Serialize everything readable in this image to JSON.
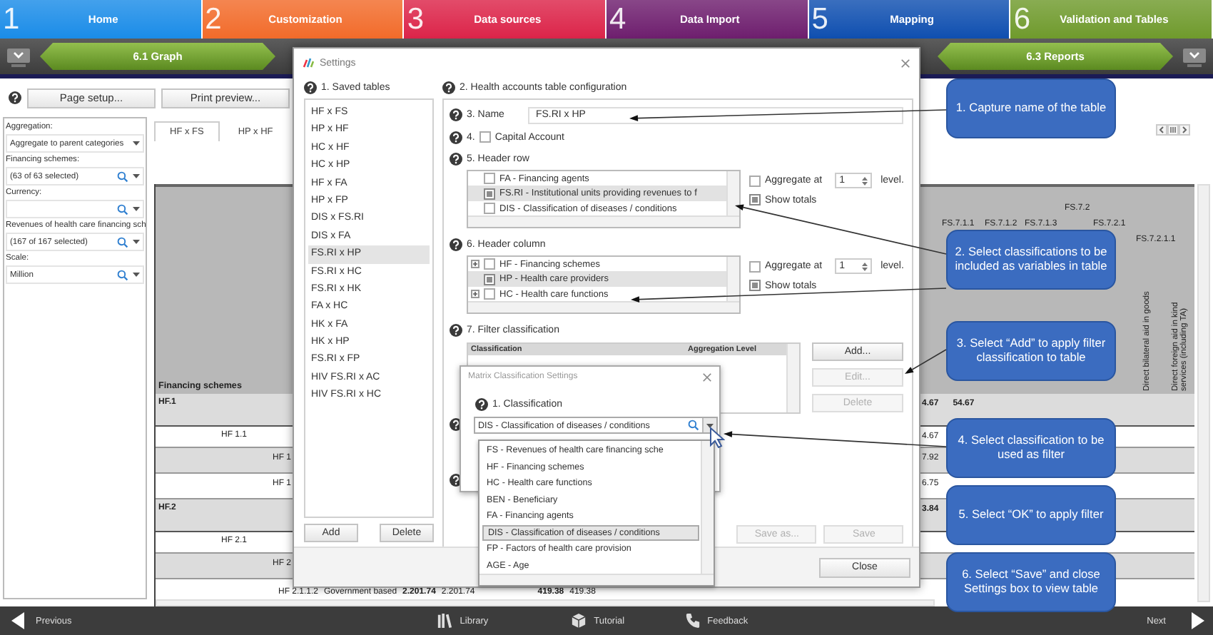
{
  "nav_steps": [
    {
      "number": "1",
      "label": "Home",
      "color": "#1a8ce8"
    },
    {
      "number": "2",
      "label": "Customization",
      "color": "#f26b2a"
    },
    {
      "number": "3",
      "label": "Data sources",
      "color": "#dc2449"
    },
    {
      "number": "4",
      "label": "Data Import",
      "color": "#6e1e6e"
    },
    {
      "number": "5",
      "label": "Mapping",
      "color": "#0f4fb0"
    },
    {
      "number": "6",
      "label": "Validation and Tables",
      "color": "#6f9a2c"
    }
  ],
  "sub_steps": [
    {
      "label": "6.1 Graph"
    },
    {
      "label": "6.3 Reports"
    }
  ],
  "toolbar": {
    "buttons": [
      "Page setup...",
      "Print preview..."
    ]
  },
  "filters": [
    {
      "label": "Aggregation:",
      "kind": "dropdown",
      "value": "Aggregate to parent categories"
    },
    {
      "label": "Financing schemes:",
      "kind": "search",
      "value": "(63 of 63 selected)"
    },
    {
      "label": "Currency:",
      "kind": "search"
    },
    {
      "label": "Revenues of health care financing sch",
      "kind": "search",
      "value": "(167 of 167 selected)"
    },
    {
      "label": "Scale:",
      "kind": "search",
      "value": "Million"
    }
  ],
  "report": {
    "tabs": [
      {
        "label": "HF x FS",
        "selected": true
      },
      {
        "label": "HP x HF",
        "selected": false
      }
    ],
    "column_headers": [
      [
        "FS.7.2"
      ],
      [
        "FS.7.1.1",
        "FS.7.1.2",
        "FS.7.1.3",
        "FS.7.2.1"
      ],
      [
        "FS.7.2.1.1"
      ]
    ],
    "column_titles": [
      "Direct bilateral aid in goods",
      "Direct foreign aid in kind services (including TA)"
    ],
    "row_header": "Financing schemes",
    "rows": [
      {
        "kind": "group",
        "shaded": true,
        "label": "HF.1",
        "values": [
          "4.67",
          "54.67"
        ]
      },
      {
        "kind": "sub",
        "shaded": false,
        "label": "HF 1.1",
        "values": [
          "4.67"
        ]
      },
      {
        "kind": "item",
        "shaded": true,
        "label": "HF 1",
        "values": [
          "7.92"
        ]
      },
      {
        "kind": "item",
        "shaded": false,
        "label": "HF 1",
        "values": [
          "6.75"
        ]
      },
      {
        "kind": "group",
        "shaded": true,
        "label": "HF.2",
        "values": [
          "3.84"
        ]
      },
      {
        "kind": "sub",
        "shaded": false,
        "label": "HF 2.1"
      },
      {
        "kind": "item",
        "shaded": true,
        "label": "HF 2"
      }
    ],
    "detail_row": {
      "code": "HF 2.1.1.2",
      "name": "Government based",
      "values": [
        "2.201.74",
        "2.201.74",
        "419.38",
        "419.38"
      ]
    }
  },
  "settings": {
    "title": "Settings",
    "saved_tables": {
      "title": "1. Saved tables",
      "items": [
        {
          "label": "HF x FS",
          "selected": false
        },
        {
          "label": "HP x HF",
          "selected": false
        },
        {
          "label": "HC x HF",
          "selected": false
        },
        {
          "label": "HC x HP",
          "selected": false
        },
        {
          "label": "HF x FA",
          "selected": false
        },
        {
          "label": "HP x FP",
          "selected": false
        },
        {
          "label": "DIS x FS.RI",
          "selected": false
        },
        {
          "label": "DIS x FA",
          "selected": false
        },
        {
          "label": "FS.RI x HP",
          "selected": true
        },
        {
          "label": "FS.RI x HC",
          "selected": false
        },
        {
          "label": "FS.RI x HK",
          "selected": false
        },
        {
          "label": "FA x HC",
          "selected": false
        },
        {
          "label": "HK x FA",
          "selected": false
        },
        {
          "label": "HK x HP",
          "selected": false
        },
        {
          "label": "FS.RI x FP",
          "selected": false
        },
        {
          "label": "HIV FS.RI x AC",
          "selected": false
        },
        {
          "label": "HIV FS.RI x HC",
          "selected": false
        }
      ],
      "buttons": [
        "Add",
        "Delete"
      ]
    },
    "config": {
      "title": "2. Health accounts table configuration",
      "name_label": "3. Name",
      "name_value": "FS.RI x HP",
      "capital": {
        "number": "4.",
        "label": "Capital Account",
        "checked": false
      },
      "header_row": {
        "title": "5. Header row",
        "items": [
          {
            "label": "FA - Financing agents",
            "checked": false,
            "selected": false,
            "expandable": false
          },
          {
            "label": "FS.RI - Institutional units providing revenues to f",
            "checked": true,
            "selected": true,
            "expandable": false
          },
          {
            "label": "DIS - Classification of diseases / conditions",
            "checked": false,
            "selected": false,
            "expandable": false
          }
        ],
        "aggregate": {
          "label": "Aggregate at",
          "checked": false,
          "value": "1",
          "suffix": "level."
        },
        "show_totals": {
          "label": "Show totals",
          "checked": true
        }
      },
      "header_column": {
        "title": "6. Header column",
        "items": [
          {
            "label": "HF - Financing schemes",
            "checked": false,
            "selected": false,
            "expandable": true
          },
          {
            "label": "HP - Health care providers",
            "checked": true,
            "selected": true,
            "expandable": false
          },
          {
            "label": "HC - Health care functions",
            "checked": false,
            "selected": false,
            "expandable": true
          }
        ],
        "aggregate": {
          "label": "Aggregate at",
          "checked": false,
          "value": "1",
          "suffix": "level."
        },
        "show_totals": {
          "label": "Show totals",
          "checked": true
        }
      },
      "filter": {
        "title": "7. Filter classification",
        "columns": [
          "Classification",
          "Aggregation Level"
        ],
        "buttons": [
          {
            "label": "Add...",
            "disabled": false
          },
          {
            "label": "Edit...",
            "disabled": true
          },
          {
            "label": "Delete",
            "disabled": true
          }
        ]
      },
      "save_buttons": [
        {
          "label": "Save as...",
          "disabled": true
        },
        {
          "label": "Save",
          "disabled": true
        }
      ]
    },
    "close_button": "Close"
  },
  "matrix_dialog": {
    "title": "Matrix Classification Settings",
    "field_label": "1. Classification",
    "value": "DIS - Classification of diseases / conditions",
    "options": [
      {
        "label": "FS - Revenues of health care financing sche",
        "selected": false
      },
      {
        "label": "HF - Financing schemes",
        "selected": false
      },
      {
        "label": "HC - Health care functions",
        "selected": false
      },
      {
        "label": "BEN - Beneficiary",
        "selected": false
      },
      {
        "label": "FA - Financing agents",
        "selected": false
      },
      {
        "label": "DIS - Classification of diseases / conditions",
        "selected": true
      },
      {
        "label": "FP - Factors of health care provision",
        "selected": false
      },
      {
        "label": "AGE - Age",
        "selected": false
      }
    ]
  },
  "callouts": [
    "1. Capture name of the table",
    "2. Select classifications to be included as variables in table",
    "3. Select “Add” to apply filter classification to table",
    "4. Select classification to be used as filter",
    "5. Select “OK” to apply filter",
    "6. Select “Save” and close Settings box to view table"
  ],
  "bottom_bar": {
    "previous": "Previous",
    "links": [
      "Library",
      "Tutorial",
      "Feedback"
    ],
    "next": "Next"
  }
}
